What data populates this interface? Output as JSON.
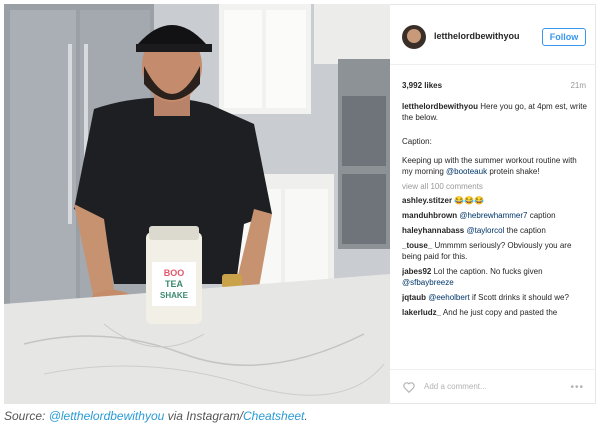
{
  "post": {
    "username": "letthelordbewithyou",
    "follow_label": "Follow",
    "likes": "3,992 likes",
    "time": "21m",
    "caption_user": "letthelordbewithyou",
    "caption_text1": "Here you go, at 4pm est, write the below.",
    "caption_label": "Caption:",
    "caption_text2": "Keeping up with the summer workout routine with my morning",
    "caption_mention": "@booteauk",
    "caption_text3": "protein shake!",
    "view_all": "view all 100 comments",
    "add_comment_placeholder": "Add a comment...",
    "more_glyph": "•••"
  },
  "comments": [
    {
      "user": "ashley.stitzer",
      "text": "😂😂😂",
      "mention": ""
    },
    {
      "user": "manduhbrown",
      "mention": "@hebrewhammer7",
      "text": "caption"
    },
    {
      "user": "haleyhannabass",
      "mention": "@taylorcol",
      "text": "the caption"
    },
    {
      "user": "_touse_",
      "mention": "",
      "text": "Ummmm seriously? Obviously you are being paid for this."
    },
    {
      "user": "jabes92",
      "mention": "@sfbaybreeze",
      "text": "Lol the caption. No fucks given"
    },
    {
      "user": "jqtaub",
      "mention": "@eeholbert",
      "text": "if Scott drinks it should we?"
    },
    {
      "user": "lakerludz_",
      "mention": "",
      "text": "And he just copy and pasted the"
    }
  ],
  "photo": {
    "jar_label_top": "BOO",
    "jar_label_mid": "TEA",
    "jar_label_bottom": "SHAKE"
  },
  "source": {
    "prefix": "Source: ",
    "handle": "@letthelordbewithyou",
    "middle": " via Instagram/",
    "site": "Cheatsheet",
    "suffix": "."
  },
  "colors": {
    "accent": "#3897f0",
    "link": "#2a9bd6",
    "mention": "#003569"
  },
  "icons": [
    "heart-icon",
    "more-icon"
  ]
}
